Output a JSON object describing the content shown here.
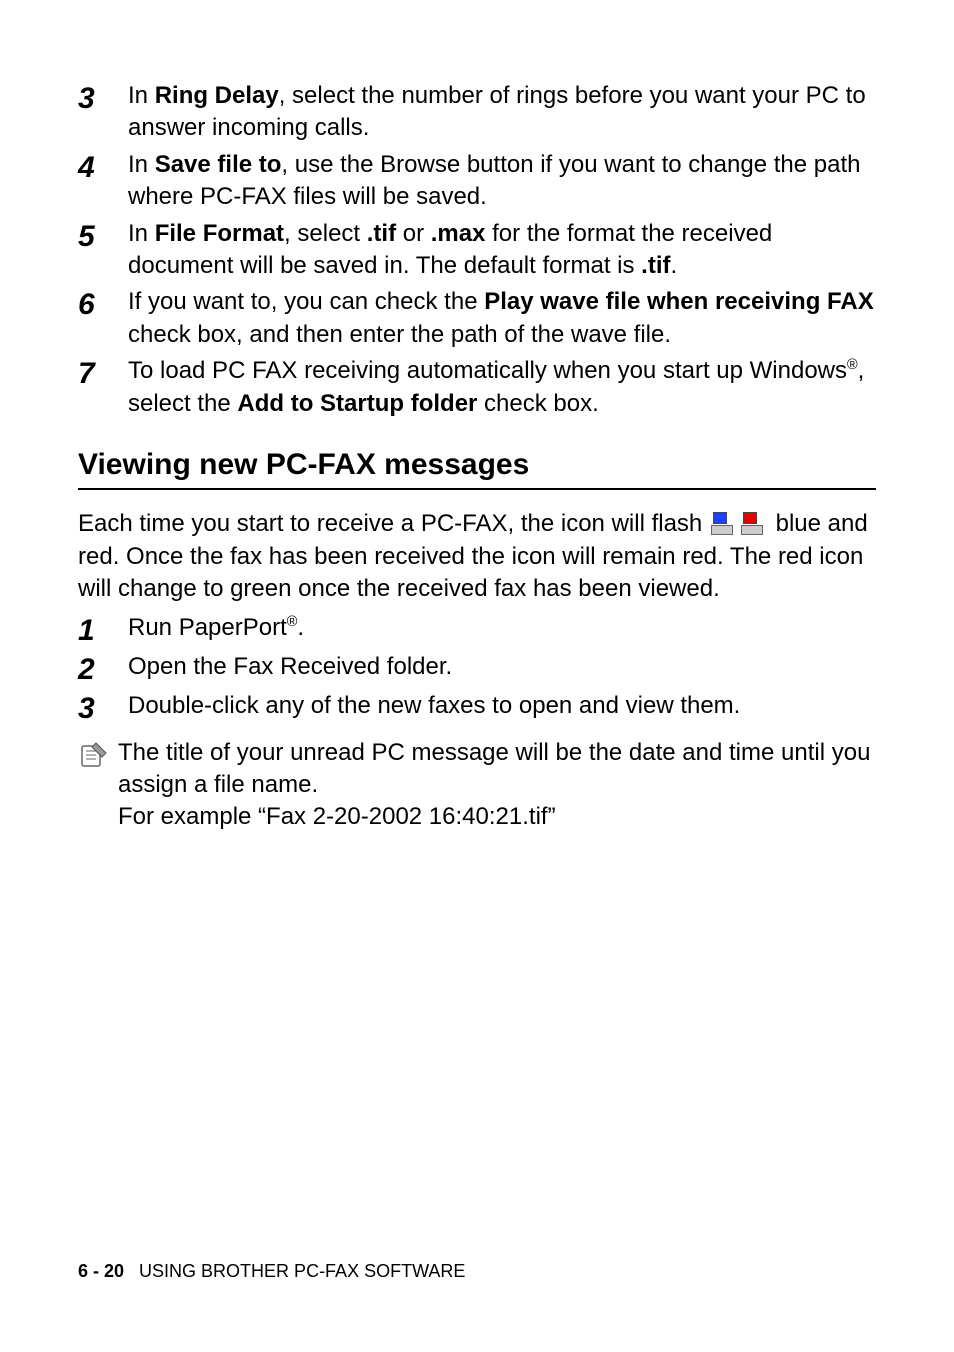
{
  "steps_top": [
    {
      "num": "3",
      "pre": "In ",
      "bold1": "Ring Delay",
      "post": ", select the number of rings before you want your PC to answer incoming calls."
    },
    {
      "num": "4",
      "pre": "In ",
      "bold1": "Save file to",
      "post": ", use the Browse button if you want to change the path where PC-FAX files will be saved."
    },
    {
      "num": "5",
      "pre": "In ",
      "bold1": "File Format",
      "mid1": ", select ",
      "bold2": ".tif",
      "mid2": " or ",
      "bold3": ".max",
      "mid3": " for the format the received document will be saved in. The default format is ",
      "bold4": ".tif",
      "post": "."
    },
    {
      "num": "6",
      "pre": "If you want to, you can check the ",
      "bold1": "Play wave file when receiving FAX",
      "post": " check box, and then enter the path of the wave file."
    },
    {
      "num": "7",
      "pre": "To load PC FAX receiving automatically when you start up Windows",
      "sup": "®",
      "mid1": ", select the ",
      "bold1": "Add to Startup folder",
      "post": " check box."
    }
  ],
  "section_heading": "Viewing new PC-FAX messages",
  "para_intro_a": "Each time you start to receive a PC-FAX, the icon will flash ",
  "para_intro_b": " blue and red. Once the fax has been received the icon will remain red. The red icon will change to green once the received fax has been viewed.",
  "steps_view": [
    {
      "num": "1",
      "text_a": "Run PaperPort",
      "sup": "®",
      "text_b": "."
    },
    {
      "num": "2",
      "text_a": "Open the Fax Received folder."
    },
    {
      "num": "3",
      "text_a": "Double-click any of the new faxes to open and view them."
    }
  ],
  "note_line1": "The title of your unread PC message will be the date and time until you assign a file name.",
  "note_line2": "For example “Fax 2-20-2002 16:40:21.tif”",
  "footer_page": "6 - 20",
  "footer_title": "USING BROTHER PC-FAX SOFTWARE"
}
